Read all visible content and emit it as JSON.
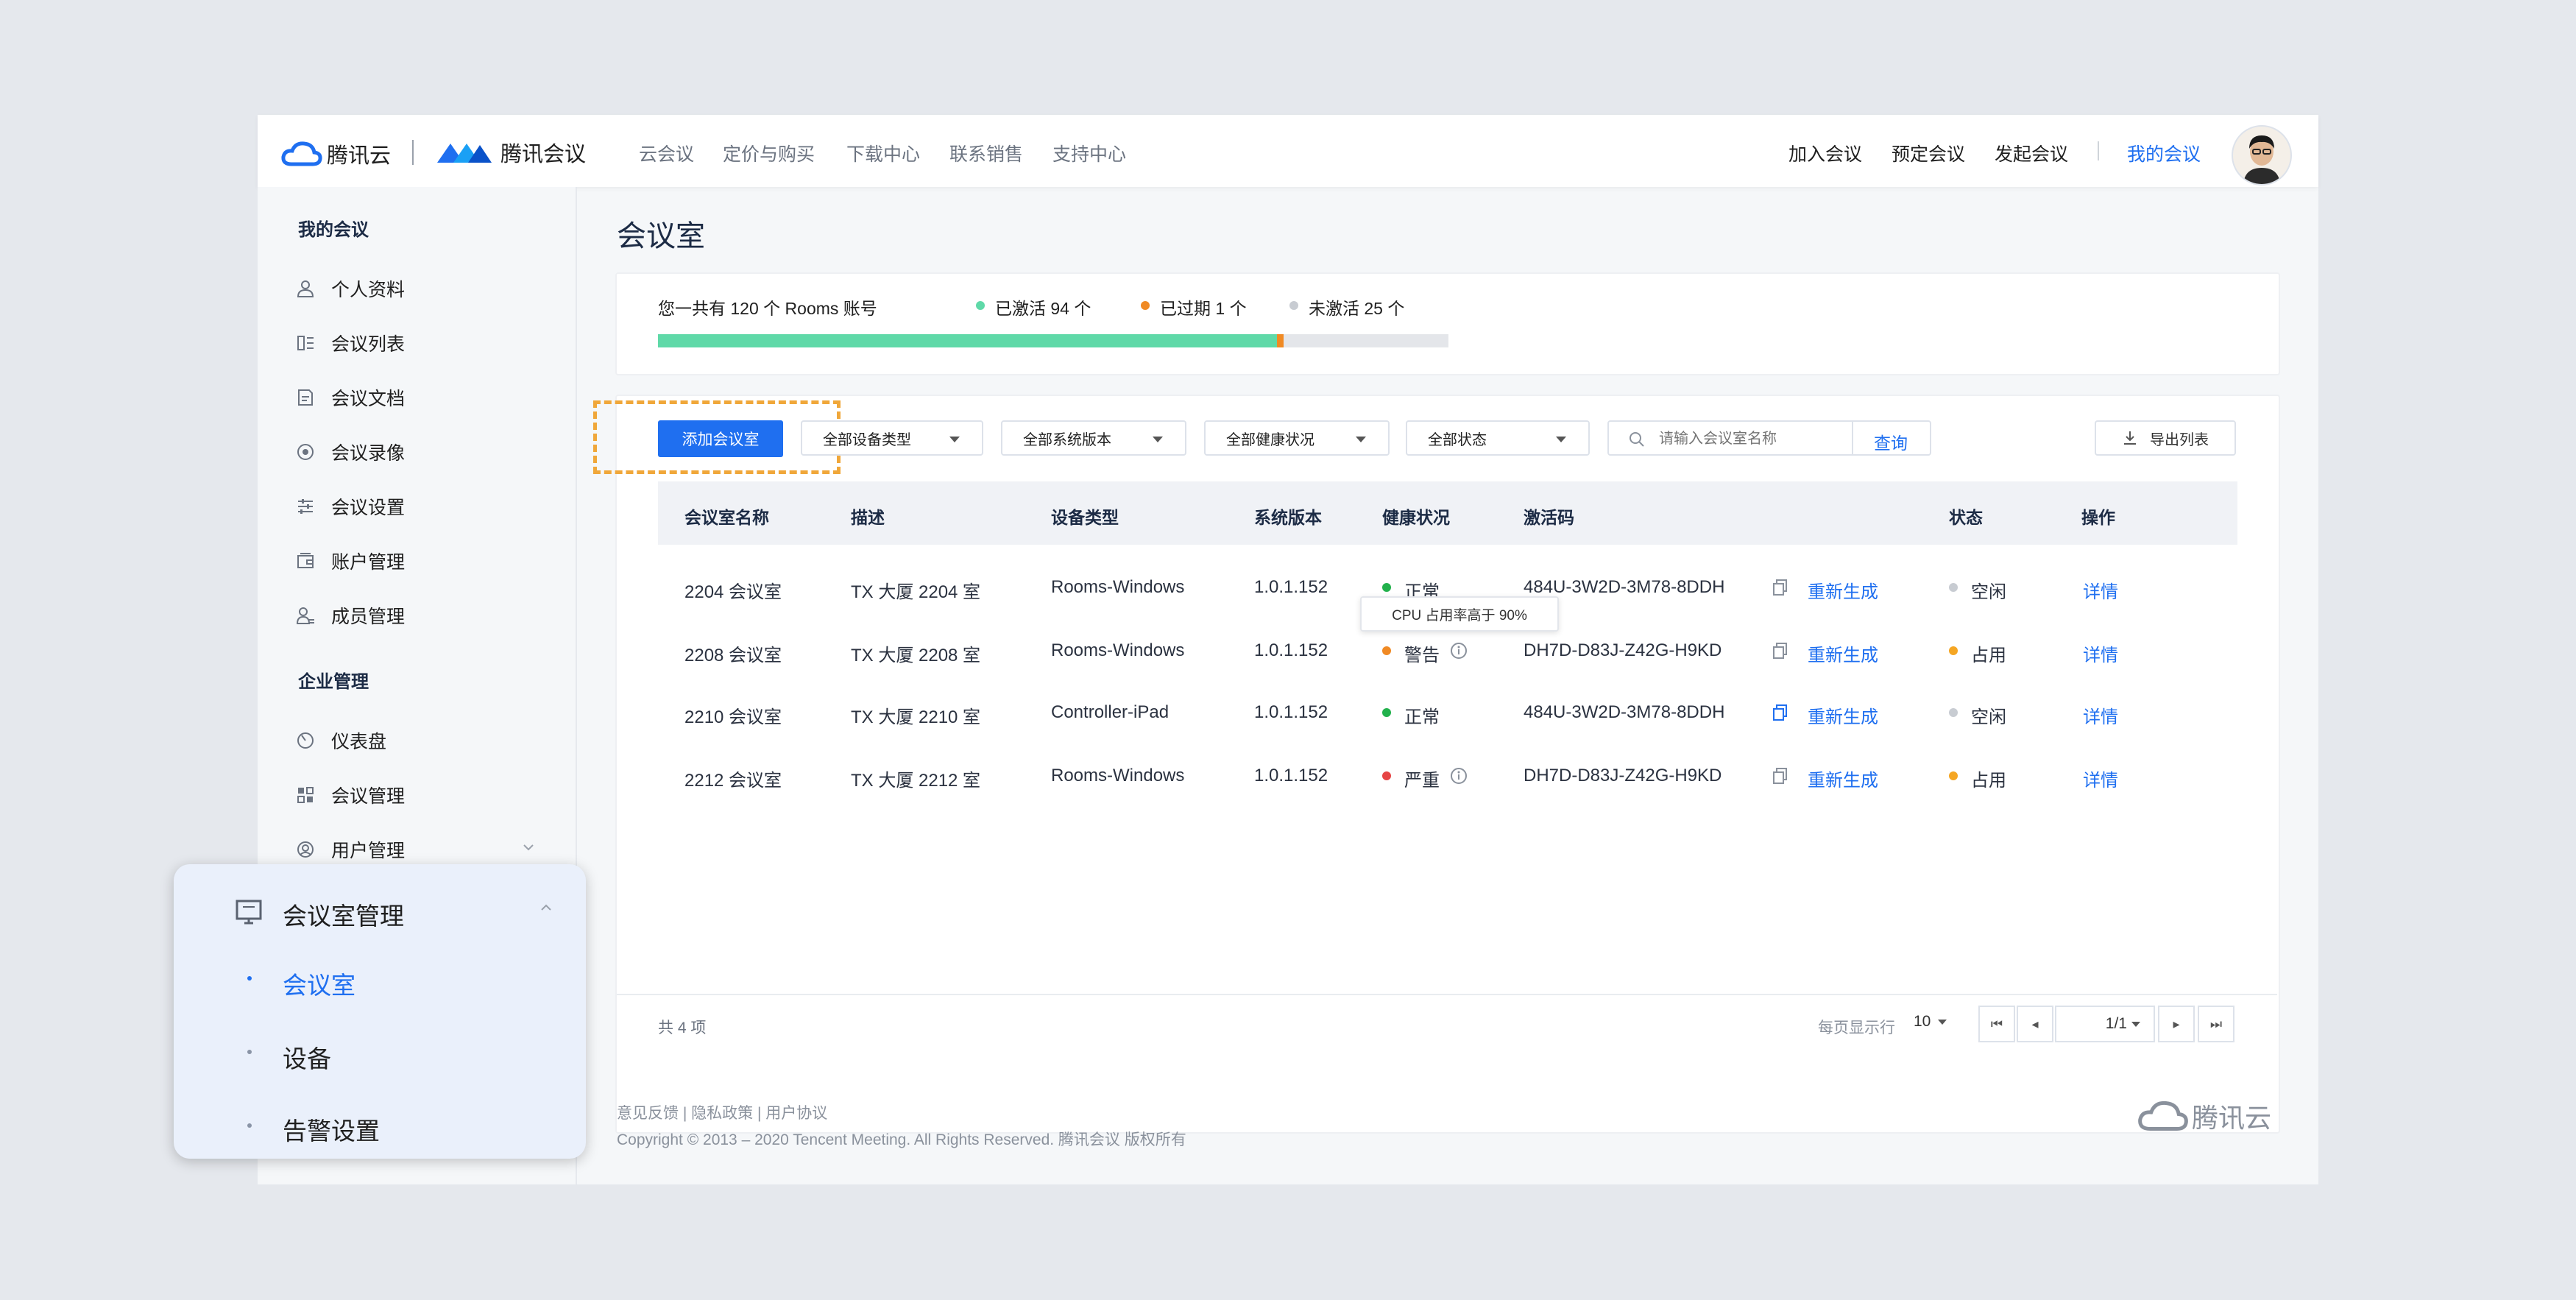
{
  "header": {
    "logo_tencent_cloud": "腾讯云",
    "logo_meeting": "腾讯会议",
    "nav": [
      "云会议",
      "定价与购买",
      "下载中心",
      "联系销售",
      "支持中心"
    ],
    "right_nav": [
      "加入会议",
      "预定会议",
      "发起会议",
      "我的会议"
    ]
  },
  "sidebar": {
    "section_my": "我的会议",
    "my_items": [
      "个人资料",
      "会议列表",
      "会议文档",
      "会议录像",
      "会议设置",
      "账户管理",
      "成员管理"
    ],
    "section_enterprise": "企业管理",
    "enterprise_items": [
      "仪表盘",
      "会议管理",
      "用户管理"
    ]
  },
  "popup": {
    "title": "会议室管理",
    "items": [
      "会议室",
      "设备",
      "告警设置"
    ]
  },
  "page_title": "会议室",
  "summary": {
    "total": "您一共有 120 个 Rooms 账号",
    "activated": "已激活 94 个",
    "expired": "已过期 1 个",
    "inactive": "未激活 25 个",
    "activated_fraction": 0.783,
    "expired_fraction": 0.008
  },
  "toolbar": {
    "add_button": "添加会议室",
    "filters": [
      "全部设备类型",
      "全部系统版本",
      "全部健康状况",
      "全部状态"
    ],
    "search_placeholder": "请输入会议室名称",
    "search_button": "查询",
    "export_button": "导出列表"
  },
  "table": {
    "headers": [
      "会议室名称",
      "描述",
      "设备类型",
      "系统版本",
      "健康状况",
      "激活码",
      "状态",
      "操作"
    ],
    "regenerate": "重新生成",
    "detail": "详情",
    "rows": [
      {
        "name": "2204 会议室",
        "desc": "TX 大厦 2204 室",
        "device": "Rooms-Windows",
        "version": "1.0.1.152",
        "health": "正常",
        "health_color": "#22b14c",
        "code": "484U-3W2D-3M78-8DDH",
        "status": "空闲",
        "status_color": "#c8ccd2"
      },
      {
        "name": "2208 会议室",
        "desc": "TX 大厦 2208 室",
        "device": "Rooms-Windows",
        "version": "1.0.1.152",
        "health": "警告",
        "health_color": "#f08a24",
        "code": "DH7D-D83J-Z42G-H9KD",
        "status": "占用",
        "status_color": "#f5a623"
      },
      {
        "name": "2210 会议室",
        "desc": "TX 大厦 2210 室",
        "device": "Controller-iPad",
        "version": "1.0.1.152",
        "health": "正常",
        "health_color": "#22b14c",
        "code": "484U-3W2D-3M78-8DDH",
        "status": "空闲",
        "status_color": "#c8ccd2"
      },
      {
        "name": "2212 会议室",
        "desc": "TX 大厦 2212 室",
        "device": "Rooms-Windows",
        "version": "1.0.1.152",
        "health": "严重",
        "health_color": "#e64545",
        "code": "DH7D-D83J-Z42G-H9KD",
        "status": "占用",
        "status_color": "#f5a623"
      }
    ],
    "tooltip": "CPU 占用率高于 90%"
  },
  "pagination": {
    "total": "共 4 项",
    "per_page_label": "每页显示行",
    "per_page": "10",
    "page": "1/1"
  },
  "footer": {
    "links": "意见反馈 | 隐私政策 | 用户协议",
    "copyright": "Copyright © 2013 – 2020 Tencent Meeting. All Rights Reserved.  腾讯会议 版权所有",
    "logo": "腾讯云"
  },
  "colors": {
    "accent": "#1f6ff0",
    "active_green": "#5fd9a8",
    "expired_orange": "#f08a24",
    "inactive_gray": "#d4d8de",
    "highlight_dash": "#f0a73a"
  }
}
